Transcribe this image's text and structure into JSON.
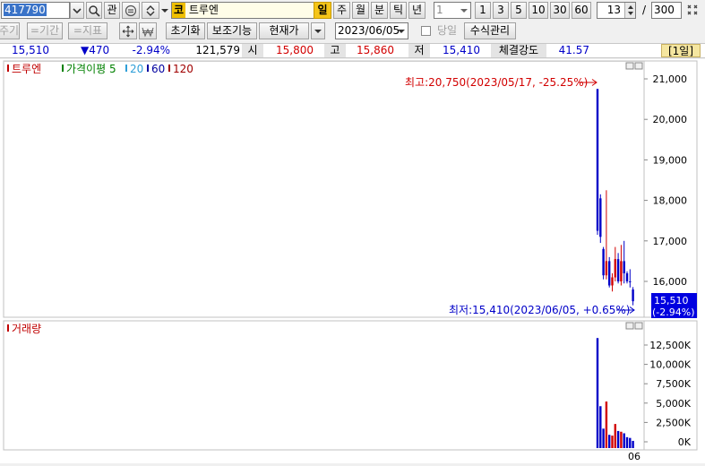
{
  "toolbar": {
    "code": "417790",
    "code_dropdown_icon": "chevron-down-icon",
    "search_icon": "search-icon",
    "gwan_label": "관",
    "link_icon": "link-icon",
    "updown_icon": "up-down-icon",
    "market_badge": "코",
    "stock_name": "트루엔",
    "periods": [
      "일",
      "주",
      "월",
      "분",
      "틱",
      "년"
    ],
    "active_period": "일",
    "interval_value": "1",
    "quick_intervals": [
      "1",
      "3",
      "5",
      "10",
      "30",
      "60"
    ],
    "count_value": "13",
    "total_slash": "/",
    "total_value": "300",
    "grid_icon": "grid-icon"
  },
  "toolbar2": {
    "cycle": "주기",
    "period_tool": "=기간",
    "indicator_tool": "=지표",
    "crosshair_icon": "crosshair-icon",
    "won_icon": "won-icon",
    "reset": "초기화",
    "aux": "보조기능",
    "current_price": "현재가",
    "date": "2023/06/05",
    "today_label": "당일",
    "formula": "수식관리"
  },
  "quote": {
    "price": "15,510",
    "change": "▼470",
    "rate": "-2.94%",
    "volume": "121,579",
    "open_label": "시",
    "open": "15,800",
    "high_label": "고",
    "high": "15,860",
    "low_label": "저",
    "low": "15,410",
    "strength_label": "체결강도",
    "strength": "41.57",
    "period_badge": "[1일]"
  },
  "colors": {
    "up": "#d20000",
    "down": "#0000c8",
    "ma20": "#2f9fd8",
    "ma60": "#0000a0",
    "ma120": "#a00000",
    "legend_name": "#c00000",
    "legend_disparity": "#008000",
    "current_badge_bg": "#0000e0"
  },
  "chart_data": [
    {
      "type": "candlestick",
      "legend": {
        "name": "트루엔",
        "disparity": "가격이평 5",
        "ma": [
          "20",
          "60",
          "120"
        ]
      },
      "y_ticks": [
        "21,000",
        "20,000",
        "19,000",
        "18,000",
        "17,000",
        "16,000"
      ],
      "ylim": [
        15300,
        21500
      ],
      "high_annotation": "최고:20,750(2023/05/17, -25.25%)",
      "low_annotation": "최저:15,410(2023/06/05, +0.65%)",
      "current_price_label": "15,510",
      "current_rate_label": "(-2.94%)",
      "ohlc": [
        {
          "open": 20750,
          "high": 20750,
          "low": 17150,
          "close": 17250
        },
        {
          "open": 18050,
          "high": 18150,
          "low": 16950,
          "close": 17100
        },
        {
          "open": 16800,
          "high": 16850,
          "low": 16050,
          "close": 16150
        },
        {
          "open": 16150,
          "high": 18250,
          "low": 16050,
          "close": 16500
        },
        {
          "open": 16500,
          "high": 16600,
          "low": 15850,
          "close": 15900
        },
        {
          "open": 15900,
          "high": 16200,
          "low": 15750,
          "close": 16100
        },
        {
          "open": 16100,
          "high": 16850,
          "low": 16000,
          "close": 16550
        },
        {
          "open": 16550,
          "high": 16700,
          "low": 15950,
          "close": 16000
        },
        {
          "open": 16000,
          "high": 16900,
          "low": 15900,
          "close": 16500
        },
        {
          "open": 16500,
          "high": 17000,
          "low": 15950,
          "close": 16200
        },
        {
          "open": 16200,
          "high": 16250,
          "low": 15950,
          "close": 16000
        },
        {
          "open": 16000,
          "high": 16300,
          "low": 15850,
          "close": 15980
        },
        {
          "open": 15800,
          "high": 15860,
          "low": 15410,
          "close": 15510
        }
      ]
    },
    {
      "type": "bar",
      "legend": {
        "name": "거래량"
      },
      "y_ticks": [
        "12,500K",
        "10,000K",
        "7,500K",
        "5,000K",
        "2,500K",
        "0K"
      ],
      "ylim": [
        0,
        13500000
      ],
      "x_tick": "06",
      "values": [
        13400000,
        4600000,
        1700000,
        5200000,
        900000,
        800000,
        2300000,
        1400000,
        1300000,
        1100000,
        600000,
        500000,
        121579
      ]
    }
  ]
}
